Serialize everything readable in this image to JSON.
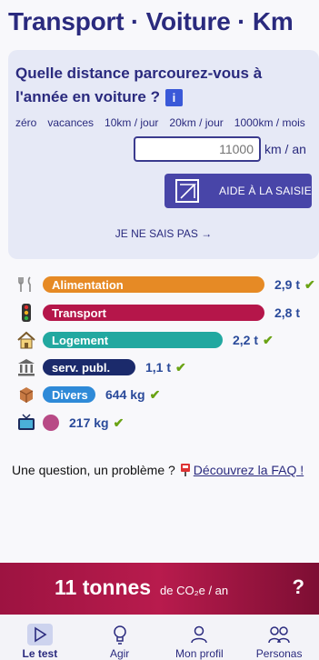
{
  "page": {
    "title": "Transport · Voiture · Km"
  },
  "question": {
    "text": "Quelle distance parcourez-vous à l'année en voiture ?",
    "info_label": "i",
    "suggestions": [
      "zéro",
      "vacances",
      "10km / jour",
      "20km / jour",
      "1000km / mois"
    ],
    "input": {
      "value": "",
      "placeholder": "11000"
    },
    "unit": "km / an",
    "help_button": "AIDE À LA SAISIE",
    "dont_know": "JE NE SAIS PAS →"
  },
  "categories": [
    {
      "label": "Alimentation",
      "value": "2,9 t",
      "color": "#e68a25",
      "icon": "fork-knife-icon",
      "done": true
    },
    {
      "label": "Transport",
      "value": "2,8 t",
      "color": "#b5164a",
      "icon": "traffic-light-icon",
      "done": false
    },
    {
      "label": "Logement",
      "value": "2,2 t",
      "color": "#22a8a0",
      "icon": "house-icon",
      "done": true
    },
    {
      "label": "serv. publ.",
      "value": "1,1 t",
      "color": "#1b2a6b",
      "icon": "government-building-icon",
      "done": true
    },
    {
      "label": "Divers",
      "value": "644 kg",
      "color": "#2e8ad8",
      "icon": "package-icon",
      "done": true
    },
    {
      "label": "",
      "value": "217 kg",
      "color": "#b84a86",
      "icon": "tv-icon",
      "done": true
    }
  ],
  "faq": {
    "question": "Une question, un problème ?",
    "link": "Découvrez la FAQ !"
  },
  "footer": {
    "total": "11 tonnes",
    "unit": "de CO₂e / an",
    "help": "?"
  },
  "nav": [
    {
      "label": "Le test",
      "icon": "play-icon",
      "active": true
    },
    {
      "label": "Agir",
      "icon": "lightbulb-icon",
      "active": false
    },
    {
      "label": "Mon profil",
      "icon": "user-icon",
      "active": false
    },
    {
      "label": "Personas",
      "icon": "users-icon",
      "active": false
    }
  ]
}
